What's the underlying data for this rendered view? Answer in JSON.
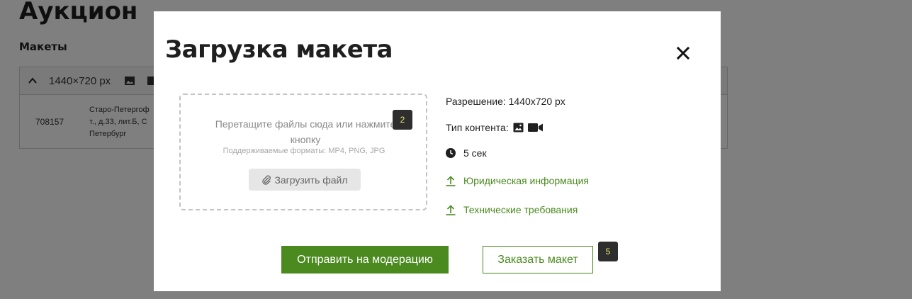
{
  "background": {
    "title": "Аукцион",
    "section": "Макеты",
    "table_header_size": "1440×720 px",
    "row": {
      "id": "708157",
      "address": "Старо-Петергоф т., д.33, лит.Б, С Петербург"
    }
  },
  "modal": {
    "title": "Загрузка макета",
    "dropzone": {
      "text": "Перетащите файлы сюда или нажмите кнопку",
      "formats": "Поддерживаемые форматы: MP4, PNG, JPG",
      "upload_label": "Загрузить файл"
    },
    "info": {
      "resolution": "Разрешение: 1440x720 px",
      "content_type": "Тип контента:",
      "duration": "5 сек",
      "legal_link": "Юридическая информация",
      "tech_link": "Технические требования"
    },
    "buttons": {
      "submit": "Отправить на модерацию",
      "order": "Заказать макет"
    }
  },
  "badges": {
    "dropzone": "2",
    "order": "5"
  },
  "icons": {
    "close": "close-icon",
    "paperclip": "paperclip-icon",
    "image": "image-icon",
    "video": "video-icon",
    "clock": "clock-icon",
    "upload": "upload-icon"
  },
  "colors": {
    "accent": "#4a8a1f",
    "overlay": "rgba(0,0,0,0.5)",
    "badge_bg": "#2e2e2e",
    "badge_text": "#e7e76a"
  }
}
